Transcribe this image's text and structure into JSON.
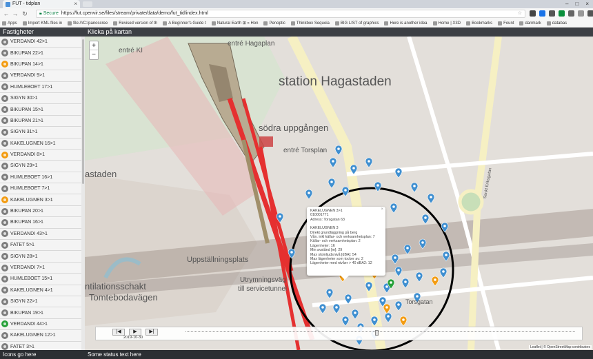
{
  "browser": {
    "tab_title": "FUT - tidplan",
    "secure_label": "Secure",
    "url": "https://fut.cpenvir.se/files/stream/private/data/demo/fut_tid/index.html",
    "bookmarks": [
      "Apps",
      "Import KML files in",
      "file:///C:/panoscree",
      "Revised version of th",
      "A Beginner's Guide t",
      "Natural Earth ⊞ » Hon",
      "Penoptic",
      "Thinkbox Sequoia",
      "BIG LIST of graphics",
      "Here is another idea",
      "Home | X3D",
      "Bookmarks",
      "Fount",
      "danmark",
      "databas"
    ]
  },
  "header": {
    "sidebar_title": "Fastigheter",
    "map_title": "Klicka på kartan"
  },
  "colors": {
    "gray": "#7d7d7d",
    "orange": "#f39c12",
    "green": "#27a13a",
    "blue": "#3f8fd0"
  },
  "sidebar": {
    "items": [
      {
        "label": "VERDANDI 42>1",
        "status": "gray"
      },
      {
        "label": "BIKUPAN 22>1",
        "status": "gray"
      },
      {
        "label": "BIKUPAN 14>1",
        "status": "orange"
      },
      {
        "label": "VERDANDI 9>1",
        "status": "gray"
      },
      {
        "label": "HUMLEBOET 17>1",
        "status": "gray"
      },
      {
        "label": "SIGYN 30>1",
        "status": "gray"
      },
      {
        "label": "BIKUPAN 15>1",
        "status": "gray"
      },
      {
        "label": "BIKUPAN 21>1",
        "status": "gray"
      },
      {
        "label": "SIGYN 31>1",
        "status": "gray"
      },
      {
        "label": "KAKELUGNEN 16>1",
        "status": "gray"
      },
      {
        "label": "VERDANDI 8>1",
        "status": "orange"
      },
      {
        "label": "SIGYN 29>1",
        "status": "gray"
      },
      {
        "label": "HUMLEBOET 16>1",
        "status": "gray"
      },
      {
        "label": "HUMLEBOET 7>1",
        "status": "gray"
      },
      {
        "label": "KAKELUGNEN 3>1",
        "status": "orange"
      },
      {
        "label": "BIKUPAN 20>1",
        "status": "gray"
      },
      {
        "label": "BIKUPAN 16>1",
        "status": "gray"
      },
      {
        "label": "VERDANDI 43>1",
        "status": "gray"
      },
      {
        "label": "FATET 5>1",
        "status": "gray"
      },
      {
        "label": "SIGYN 28>1",
        "status": "gray"
      },
      {
        "label": "VERDANDI 7>1",
        "status": "gray"
      },
      {
        "label": "HUMLEBOET 15>1",
        "status": "gray"
      },
      {
        "label": "KAKELUGNEN 4>1",
        "status": "gray"
      },
      {
        "label": "SIGYN 22>1",
        "status": "gray"
      },
      {
        "label": "BIKUPAN 19>1",
        "status": "gray"
      },
      {
        "label": "VERDANDI 44>1",
        "status": "green"
      },
      {
        "label": "KAKELUGNEN 12>1",
        "status": "gray"
      },
      {
        "label": "FATET 3>1",
        "status": "gray"
      }
    ]
  },
  "map": {
    "labels": {
      "entre_ki": "entré KI",
      "entre_hagaplan": "entré Hagaplan",
      "station": "station Hagastaden",
      "sodra": "södra uppgången",
      "entre_torsplan": "entré Torsplan",
      "hagastaden": "astaden",
      "uppstallning": "Uppställningsplats",
      "ventilation": "ntilationsschakt",
      "tomteboda": "Tomtebodavägen",
      "utrymning": "Utrymningsväg",
      "servicetunnel": "till servicetunnel",
      "torsgatan": "Torsgatan",
      "sankt": "Sankt Eriksgatan"
    },
    "zoom_in": "+",
    "zoom_out": "−",
    "popup": {
      "close": "×",
      "lines_a": [
        "KAKELUGNEN 3>1",
        "010001771",
        "Adress: Torsgatan 63"
      ],
      "lines_b": [
        "KAKELUGNEN 3",
        "Direkt grundläggning på berg",
        "Vån. inkl källar- och verksamhetsplan: 7",
        "Källar- och verksamhetsplan: 2",
        "Lägenheter: 16",
        "Min avstånd [m]: 29",
        "Max stomljudsnivå [dBA]: 54",
        "Max lägenheter som tocker av: 2",
        "Lägenheter med nivåer > 40 dBA2: 12"
      ]
    },
    "attribution": "Leaflet | © OpenStreetMap contributors"
  },
  "timeline": {
    "date": "2019-10-30",
    "btn_first": "|◀",
    "btn_play": "▶",
    "btn_last": "▶|"
  },
  "footer": {
    "left": "Icons go here",
    "right": "Some status text here"
  }
}
